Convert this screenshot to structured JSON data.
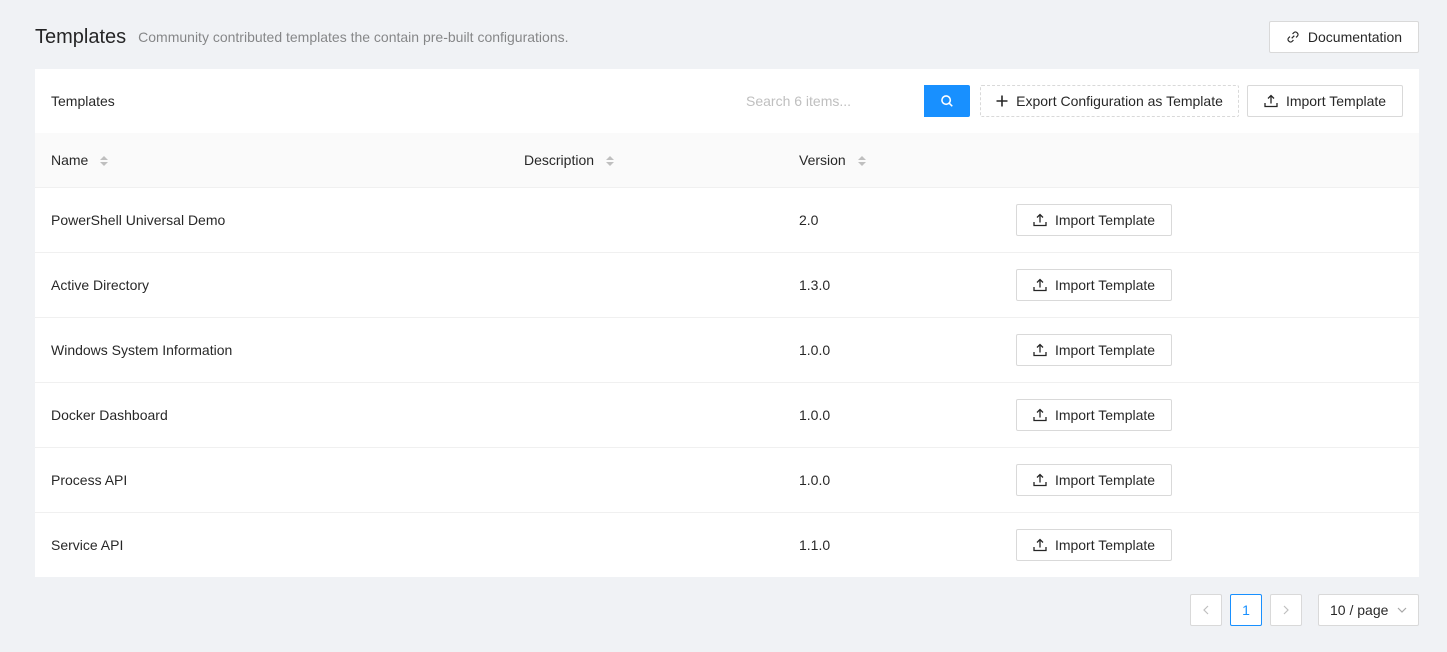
{
  "header": {
    "title": "Templates",
    "subtitle": "Community contributed templates the contain pre-built configurations.",
    "documentation_label": "Documentation"
  },
  "toolbar": {
    "title": "Templates",
    "search_placeholder": "Search 6 items...",
    "export_label": "Export Configuration as Template",
    "import_label": "Import Template"
  },
  "table": {
    "columns": [
      "Name",
      "Description",
      "Version"
    ],
    "rows": [
      {
        "name": "PowerShell Universal Demo",
        "description": "",
        "version": "2.0",
        "action": "Import Template"
      },
      {
        "name": "Active Directory",
        "description": "",
        "version": "1.3.0",
        "action": "Import Template"
      },
      {
        "name": "Windows System Information",
        "description": "",
        "version": "1.0.0",
        "action": "Import Template"
      },
      {
        "name": "Docker Dashboard",
        "description": "",
        "version": "1.0.0",
        "action": "Import Template"
      },
      {
        "name": "Process API",
        "description": "",
        "version": "1.0.0",
        "action": "Import Template"
      },
      {
        "name": "Service API",
        "description": "",
        "version": "1.1.0",
        "action": "Import Template"
      }
    ]
  },
  "pagination": {
    "current_page": "1",
    "page_size": "10 / page"
  },
  "colors": {
    "primary": "#1890ff",
    "background": "#f0f2f5"
  }
}
